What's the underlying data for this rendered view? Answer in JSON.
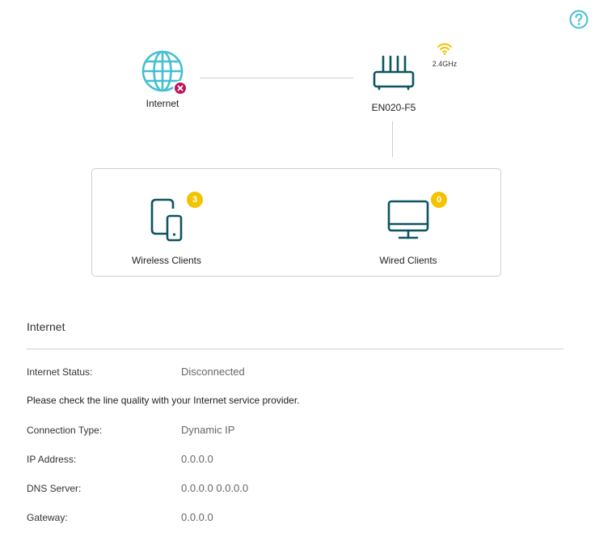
{
  "colors": {
    "accent": "#44bfd3",
    "icon_dark": "#0d5460",
    "error": "#b8185b",
    "badge": "#f3c300",
    "wifi": "#f3c300"
  },
  "help": {
    "icon": "help-circle-icon"
  },
  "topology": {
    "internet": {
      "label": "Internet",
      "icon": "globe-icon",
      "status_icon": "close-icon"
    },
    "router": {
      "label": "EN020-F5",
      "icon": "router-icon"
    },
    "band": {
      "label": "2.4GHz",
      "icon": "wifi-icon"
    },
    "clients": {
      "wireless": {
        "label": "Wireless Clients",
        "count": "3",
        "icon": "tablet-phone-icon"
      },
      "wired": {
        "label": "Wired Clients",
        "count": "0",
        "icon": "monitor-icon"
      }
    }
  },
  "internet_section": {
    "title": "Internet",
    "status_label": "Internet Status:",
    "status_value": "Disconnected",
    "note": "Please check the line quality with your Internet service provider.",
    "rows": [
      {
        "label": "Connection Type:",
        "value": "Dynamic IP"
      },
      {
        "label": "IP Address:",
        "value": "0.0.0.0"
      },
      {
        "label": "DNS Server:",
        "value": "0.0.0.0 0.0.0.0"
      },
      {
        "label": "Gateway:",
        "value": "0.0.0.0"
      }
    ]
  }
}
